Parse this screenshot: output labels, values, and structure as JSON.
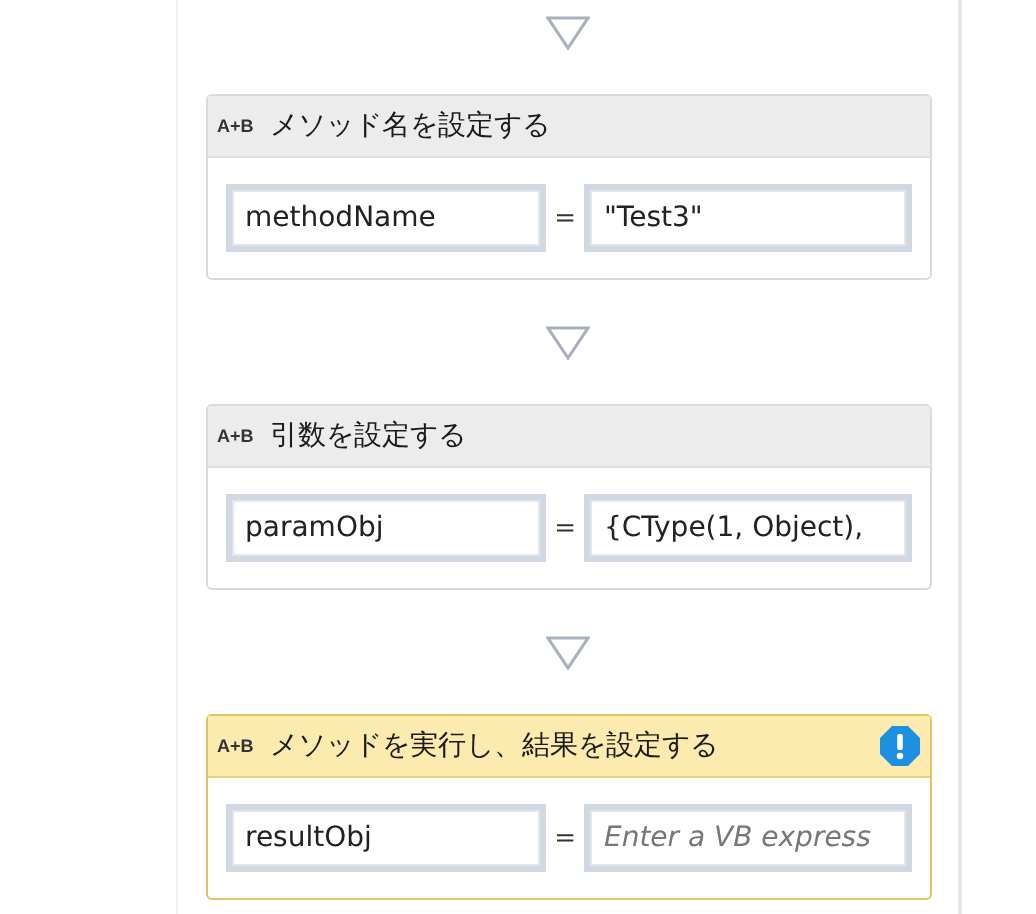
{
  "activities": [
    {
      "icon": "A+B",
      "title": "メソッド名を設定する",
      "selected": false,
      "warning": false,
      "variable": "methodName",
      "operator": "=",
      "value": "\"Test3\""
    },
    {
      "icon": "A+B",
      "title": "引数を設定する",
      "selected": false,
      "warning": false,
      "variable": "paramObj",
      "operator": "=",
      "value": "{CType(1, Object), "
    },
    {
      "icon": "A+B",
      "title": "メソッドを実行し、結果を設定する",
      "selected": true,
      "warning": true,
      "variable": "resultObj",
      "operator": "=",
      "placeholder": "Enter a VB express"
    }
  ]
}
